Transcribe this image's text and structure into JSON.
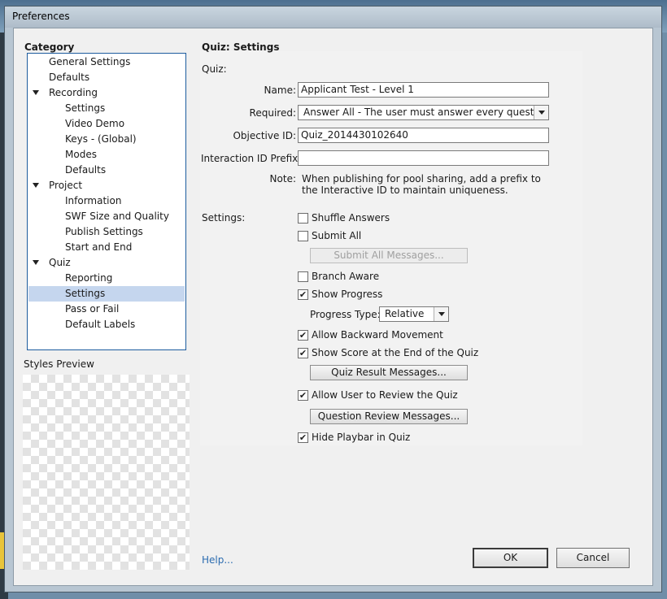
{
  "window": {
    "title": "Preferences"
  },
  "category": {
    "heading": "Category",
    "items": [
      {
        "label": "General Settings",
        "level": 0,
        "expandable": false,
        "selected": false
      },
      {
        "label": "Defaults",
        "level": 0,
        "expandable": false,
        "selected": false
      },
      {
        "label": "Recording",
        "level": 0,
        "expandable": true,
        "selected": false
      },
      {
        "label": "Settings",
        "level": 1,
        "expandable": false,
        "selected": false
      },
      {
        "label": "Video Demo",
        "level": 1,
        "expandable": false,
        "selected": false
      },
      {
        "label": "Keys - (Global)",
        "level": 1,
        "expandable": false,
        "selected": false
      },
      {
        "label": "Modes",
        "level": 1,
        "expandable": false,
        "selected": false
      },
      {
        "label": "Defaults",
        "level": 1,
        "expandable": false,
        "selected": false
      },
      {
        "label": "Project",
        "level": 0,
        "expandable": true,
        "selected": false
      },
      {
        "label": "Information",
        "level": 1,
        "expandable": false,
        "selected": false
      },
      {
        "label": "SWF Size and Quality",
        "level": 1,
        "expandable": false,
        "selected": false
      },
      {
        "label": "Publish Settings",
        "level": 1,
        "expandable": false,
        "selected": false
      },
      {
        "label": "Start and End",
        "level": 1,
        "expandable": false,
        "selected": false
      },
      {
        "label": "Quiz",
        "level": 0,
        "expandable": true,
        "selected": false
      },
      {
        "label": "Reporting",
        "level": 1,
        "expandable": false,
        "selected": false
      },
      {
        "label": "Settings",
        "level": 1,
        "expandable": false,
        "selected": true
      },
      {
        "label": "Pass or Fail",
        "level": 1,
        "expandable": false,
        "selected": false
      },
      {
        "label": "Default Labels",
        "level": 1,
        "expandable": false,
        "selected": false
      }
    ],
    "styles_preview_label": "Styles Preview"
  },
  "panel": {
    "heading": "Quiz: Settings",
    "quiz_section_label": "Quiz:",
    "name_label": "Name:",
    "name_value": "Applicant Test - Level 1",
    "required_label": "Required:",
    "required_value": "Answer All - The user must answer every questio...",
    "objective_label": "Objective ID:",
    "objective_value": "Quiz_2014430102640",
    "interaction_label": "Interaction ID Prefix:",
    "interaction_value": "",
    "note_label": "Note:",
    "note_line1": "When publishing for pool sharing, add a prefix to",
    "note_line2": "the Interactive ID to maintain uniqueness.",
    "settings_label": "Settings:",
    "shuffle_answers": {
      "label": "Shuffle Answers",
      "checked": false
    },
    "submit_all": {
      "label": "Submit All",
      "checked": false
    },
    "submit_all_messages_button": "Submit All Messages...",
    "branch_aware": {
      "label": "Branch Aware",
      "checked": false
    },
    "show_progress": {
      "label": "Show Progress",
      "checked": true
    },
    "progress_type_label": "Progress Type:",
    "progress_type_value": "Relative",
    "allow_backward": {
      "label": "Allow Backward Movement",
      "checked": true
    },
    "show_score": {
      "label": "Show Score at the End of the Quiz",
      "checked": true
    },
    "quiz_result_messages_button": "Quiz Result Messages...",
    "allow_review": {
      "label": "Allow User to Review the Quiz",
      "checked": true
    },
    "question_review_messages_button": "Question Review Messages...",
    "hide_playbar": {
      "label": "Hide Playbar in Quiz",
      "checked": true
    }
  },
  "footer": {
    "help_link": "Help...",
    "ok_button": "OK",
    "cancel_button": "Cancel"
  },
  "colors": {
    "selection": "#c5d6ee",
    "tree_border": "#1d5c9e",
    "link": "#2b6cb0"
  }
}
